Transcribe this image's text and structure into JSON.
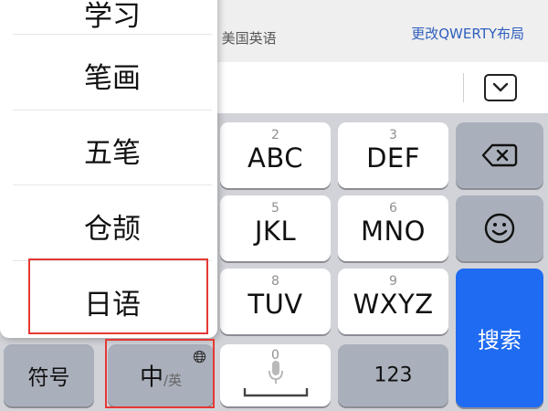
{
  "top_bar": {
    "paren": ")",
    "language_hint": "美国英语",
    "change_layout": "更改QWERTY布局"
  },
  "popup_menu": {
    "items": [
      "学习",
      "笔画",
      "五笔",
      "仓颉",
      "日语"
    ]
  },
  "keys": {
    "k2": {
      "number": "2",
      "letters": "ABC"
    },
    "k3": {
      "number": "3",
      "letters": "DEF"
    },
    "k5": {
      "number": "5",
      "letters": "JKL"
    },
    "k6": {
      "number": "6",
      "letters": "MNO"
    },
    "k8": {
      "number": "8",
      "letters": "TUV"
    },
    "k9": {
      "number": "9",
      "letters": "WXYZ"
    },
    "k0": {
      "number": "0"
    },
    "search": "搜索",
    "symbols": "符号",
    "zh": "中",
    "en": "/英",
    "numbers": "123"
  },
  "colors": {
    "search_key": "#1f6bf1",
    "highlight": "#e53935",
    "link": "#2f5fbf"
  },
  "icons": [
    "chevron-down-icon",
    "backspace-icon",
    "emoji-icon",
    "globe-icon",
    "microphone-icon"
  ]
}
